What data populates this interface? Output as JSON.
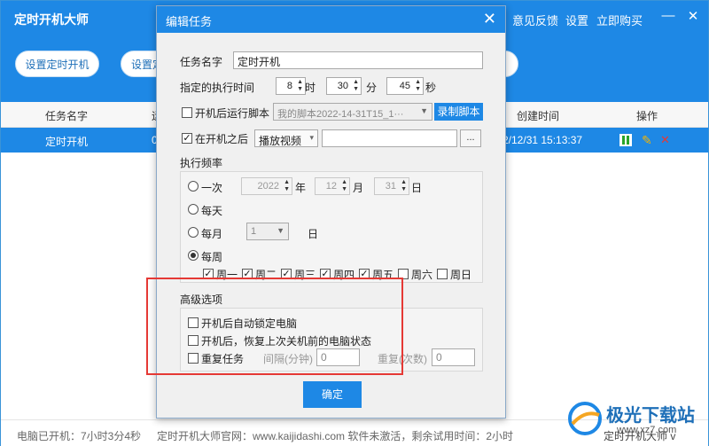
{
  "app": {
    "title": "定时开机大师",
    "top_links": [
      "意见反馈",
      "设置",
      "立即购买"
    ],
    "window_buttons": {
      "minimize": "—",
      "close": "✕"
    },
    "buttons": [
      "设置定时开机",
      "设置定"
    ]
  },
  "table": {
    "headers": [
      "任务名字",
      "运",
      "创建时间",
      "操作"
    ],
    "rows": [
      {
        "name": "定时开机",
        "status": "0",
        "created": "2/12/31 15:13:37"
      }
    ]
  },
  "footer": {
    "uptime": "电脑已开机：7小时3分4秒",
    "site": "定时开机大师官网：www.kaijidashi.com 软件未激活，剩余试用时间：2小时",
    "right": "定时开机大师 v"
  },
  "dialog": {
    "title": "编辑任务",
    "close": "✕",
    "task_name_label": "任务名字",
    "task_name_value": "定时开机",
    "exec_time_label": "指定的执行时间",
    "hour": "8",
    "hour_unit": "时",
    "minute": "30",
    "minute_unit": "分",
    "second": "45",
    "second_unit": "秒",
    "run_script_label": "开机后运行脚本",
    "script_select": "我的脚本2022-14-31T15_1···",
    "record_script": "录制脚本",
    "after_boot_label": "在开机之后",
    "after_boot_action": "播放视频",
    "browse": "...",
    "freq_label": "执行频率",
    "once_label": "一次",
    "once_year": "2022",
    "year_unit": "年",
    "once_month": "12",
    "month_unit": "月",
    "once_day": "31",
    "day_unit": "日",
    "daily_label": "每天",
    "monthly_label": "每月",
    "monthly_day": "1",
    "monthly_unit": "日",
    "weekly_label": "每周",
    "weekdays": [
      {
        "label": "周一",
        "checked": true
      },
      {
        "label": "周二",
        "checked": true
      },
      {
        "label": "周三",
        "checked": true
      },
      {
        "label": "周四",
        "checked": true
      },
      {
        "label": "周五",
        "checked": true
      },
      {
        "label": "周六",
        "checked": false
      },
      {
        "label": "周日",
        "checked": false
      }
    ],
    "advanced_label": "高级选项",
    "adv_lock": "开机后自动锁定电脑",
    "adv_restore": "开机后，恢复上次关机前的电脑状态",
    "adv_repeat": "重复任务",
    "interval_label": "间隔(分钟)",
    "interval_value": "0",
    "repeat_count_label": "重复(次数)",
    "repeat_count_value": "0",
    "ok": "确定"
  },
  "watermark": {
    "text": "极光下载站",
    "url": "www.xz7.com"
  },
  "colors": {
    "accent": "#1e88e5",
    "highlight": "#e53935"
  }
}
